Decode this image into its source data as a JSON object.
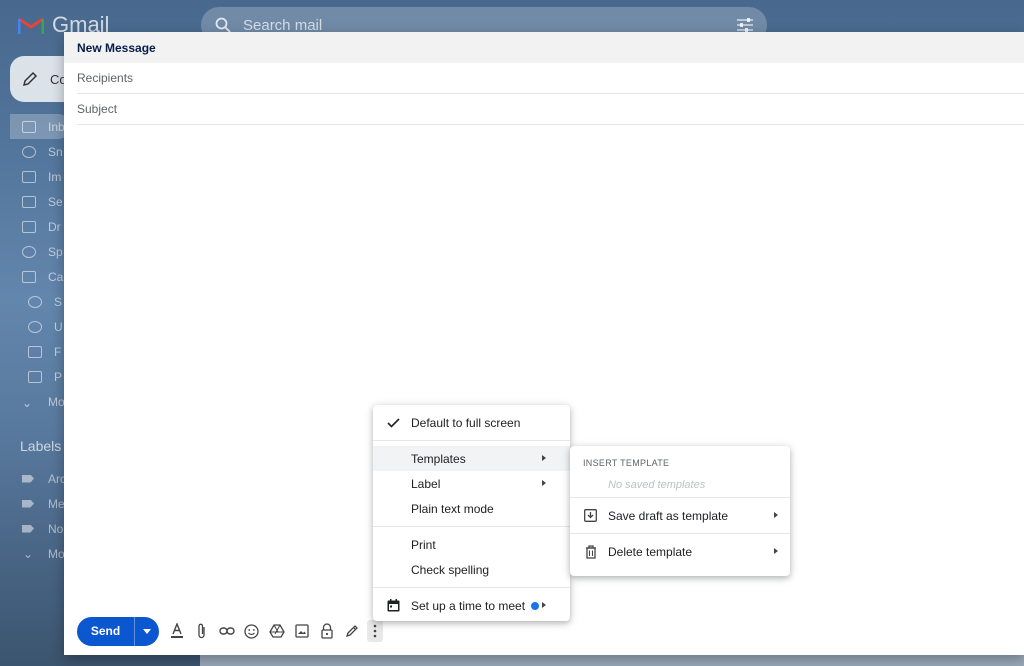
{
  "app": {
    "name": "Gmail"
  },
  "search": {
    "placeholder": "Search mail"
  },
  "compose_button": {
    "label": "Co"
  },
  "sidebar": {
    "items": [
      {
        "label": "Inb",
        "icon": "inbox-icon"
      },
      {
        "label": "Sn",
        "icon": "clock-icon"
      },
      {
        "label": "Im",
        "icon": "important-icon"
      },
      {
        "label": "Se",
        "icon": "send-icon"
      },
      {
        "label": "Dr",
        "icon": "draft-icon"
      },
      {
        "label": "Sp",
        "icon": "spam-icon"
      },
      {
        "label": "Ca",
        "icon": "label-icon"
      },
      {
        "label": "S",
        "icon": "people-icon"
      },
      {
        "label": "U",
        "icon": "info-icon"
      },
      {
        "label": "F",
        "icon": "forum-icon"
      },
      {
        "label": "P",
        "icon": "tag-icon"
      },
      {
        "label": "Mo",
        "icon": "chevron-down-icon"
      }
    ],
    "labels_heading": "Labels",
    "labels": [
      {
        "label": "Arc"
      },
      {
        "label": "Me"
      },
      {
        "label": "No"
      },
      {
        "label": "Mo"
      }
    ]
  },
  "compose": {
    "title": "New Message",
    "recipients_placeholder": "Recipients",
    "subject_placeholder": "Subject",
    "send_label": "Send"
  },
  "more_menu": {
    "items": [
      {
        "label": "Default to full screen",
        "checked": true
      },
      {
        "label": "Templates",
        "submenu": true,
        "highlighted": true
      },
      {
        "label": "Label",
        "submenu": true
      },
      {
        "label": "Plain text mode"
      },
      {
        "label": "Print"
      },
      {
        "label": "Check spelling"
      },
      {
        "label": "Set up a time to meet",
        "submenu": true,
        "icon": "calendar-icon"
      }
    ]
  },
  "templates_menu": {
    "heading": "INSERT TEMPLATE",
    "empty_text": "No saved templates",
    "items": [
      {
        "label": "Save draft as template",
        "icon": "save-template-icon"
      },
      {
        "label": "Delete template",
        "icon": "trash-icon"
      }
    ]
  },
  "colors": {
    "accent": "#0b57d0",
    "dot": "#1a73e8"
  }
}
